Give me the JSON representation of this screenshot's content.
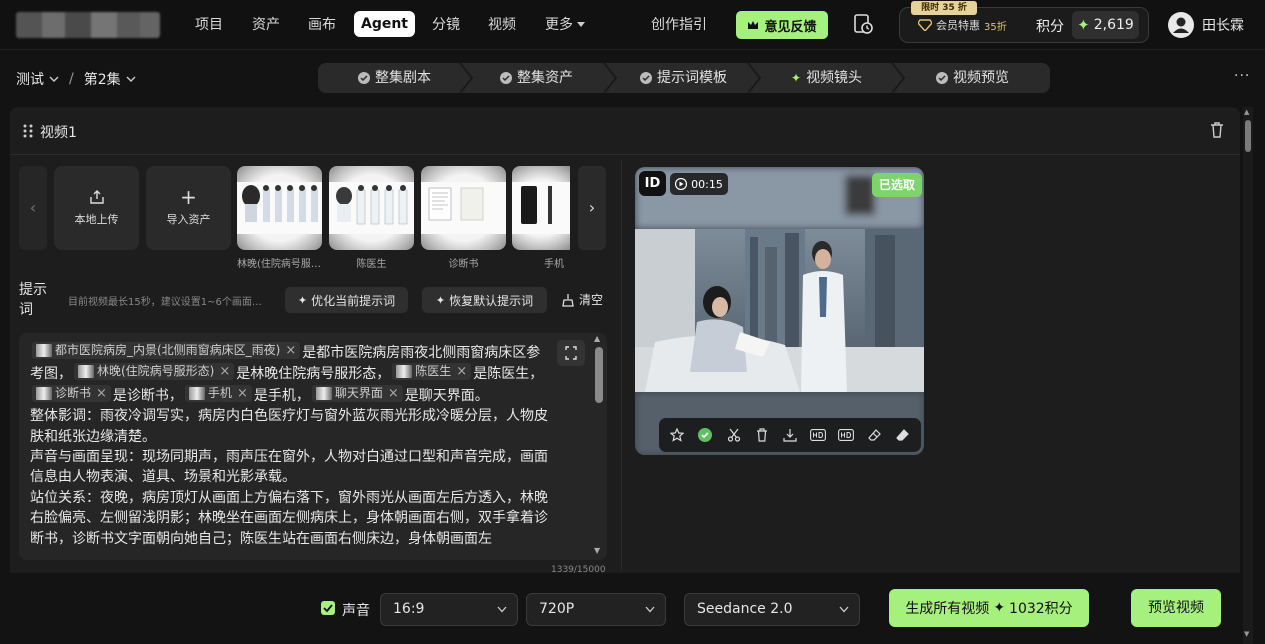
{
  "nav": {
    "items": [
      "项目",
      "资产",
      "画布",
      "Agent",
      "分镜",
      "视频",
      "更多"
    ],
    "guide": "创作指引",
    "feedback": "意见反馈",
    "limited_badge": "限时 35 折",
    "member_label": "会员特惠",
    "member_discount": "35折",
    "points_label": "积分",
    "points_value": "2,619",
    "username": "田长霖"
  },
  "breadcrumb": {
    "project": "测试",
    "separator": "/",
    "episode": "第2集"
  },
  "steps": [
    "整集剧本",
    "整集资产",
    "提示词模板",
    "视频镜头",
    "视频预览"
  ],
  "panel": {
    "title": "视频1"
  },
  "assets": {
    "upload_label": "本地上传",
    "import_label": "导入资产",
    "items": [
      "林晚(住院病号服形态)",
      "陈医生",
      "诊断书",
      "手机"
    ]
  },
  "prompt": {
    "label": "提示词",
    "hint": "目前视频最长15秒，建议设置1~6个画面…",
    "optimize_label": "优化当前提示词",
    "restore_label": "恢复默认提示词",
    "clear_label": "清空",
    "tags": {
      "scene": "都市医院病房_内景(北侧雨窗病床区_雨夜)",
      "linwan": "林晚(住院病号服形态)",
      "doctor": "陈医生",
      "diagnosis": "诊断书",
      "phone": "手机",
      "chat": "聊天界面"
    },
    "text": {
      "t1": "是都市医院病房雨夜北侧雨窗病床区参考图，",
      "t2": "是林晚住院病号服形态，",
      "t3": "是陈医生，",
      "t4": "是诊断书，",
      "t5": "是手机，",
      "t6": "是聊天界面。",
      "p2": "整体影调：雨夜冷调写实，病房内白色医疗灯与窗外蓝灰雨光形成冷暖分层，人物皮肤和纸张边缘清楚。",
      "p3": "声音与画面呈现：现场同期声，雨声压在窗外，人物对白通过口型和声音完成，画面信息由人物表演、道具、场景和光影承载。",
      "p4": "站位关系：夜晚，病房顶灯从画面上方偏右落下，窗外雨光从画面左后方透入，林晚右脸偏亮、左侧留浅阴影；林晚坐在画面左侧病床上，身体朝画面右侧，双手拿着诊断书，诊断书文字面朝向她自己；陈医生站在画面右侧床边，身体朝画面左"
    },
    "counter": "1339/15000"
  },
  "video": {
    "id_label": "ID",
    "duration": "00:15",
    "selected_label": "已选取"
  },
  "bottom": {
    "sound_label": "声音",
    "ratio": "16:9",
    "resolution": "720P",
    "model": "Seedance 2.0",
    "generate_label": "生成所有视频",
    "generate_cost": "1032积分",
    "preview_label": "预览视频"
  },
  "colors": {
    "accent": "#a6f07d",
    "selected": "#7ed36a",
    "bg": "#131313",
    "panel": "#1d1d1d"
  }
}
